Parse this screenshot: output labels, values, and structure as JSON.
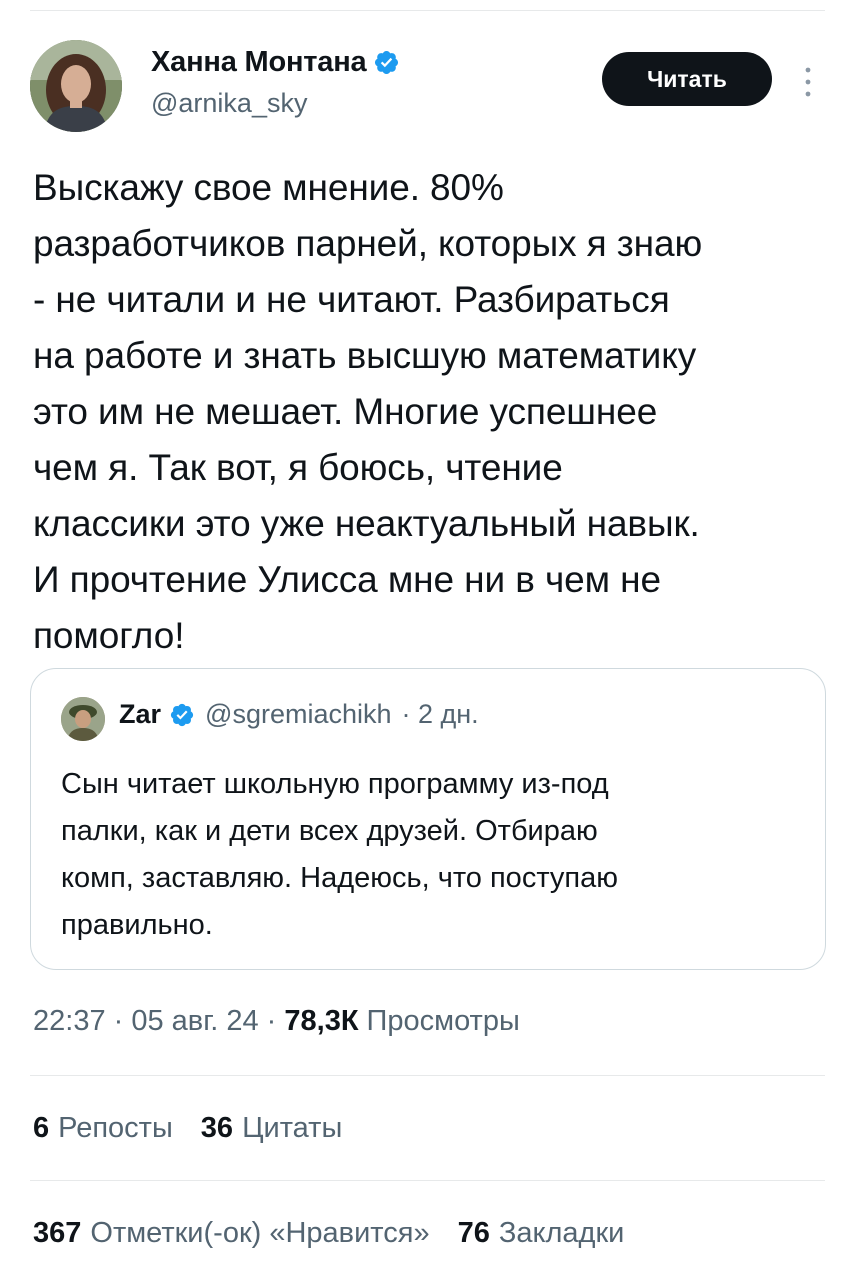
{
  "author": {
    "display_name": "Ханна Монтана",
    "handle": "@arnika_sky",
    "follow_label": "Читать"
  },
  "tweet": {
    "text": "Выскажу свое мнение. 80%\nразработчиков парней, которых я знаю\n- не читали и не читают. Разбираться\nна работе и знать высшую математику\nэто им не мешает. Многие успешнее\nчем я. Так вот, я боюсь, чтение\nклассики это уже неактуальный навык.\nИ прочтение Улисса мне ни в чем не\nпомогло!"
  },
  "quote": {
    "display_name": "Zar",
    "handle": "@sgremiachikh",
    "age": "· 2 дн.",
    "text": "Сын читает школьную программу из-под\nпалки, как и дети всех друзей. Отбираю\nкомп, заставляю. Надеюсь, что поступаю\nправильно."
  },
  "meta": {
    "time_date": "22:37 · 05 авг. 24 · ",
    "views_count": "78,3К",
    "views_label": "Просмотры"
  },
  "stats_row1": {
    "reposts_count": "6",
    "reposts_label": "Репосты",
    "quotes_count": "36",
    "quotes_label": "Цитаты"
  },
  "stats_row2": {
    "likes_count": "367",
    "likes_label": "Отметки(-ок) «Нравится»",
    "bookmarks_count": "76",
    "bookmarks_label": "Закладки"
  },
  "colors": {
    "verified": "#1d9bf0",
    "secondary_text": "#536471",
    "follow_button_bg": "#0f1419"
  },
  "icons": [
    "verified-badge-icon",
    "more-options-icon"
  ]
}
